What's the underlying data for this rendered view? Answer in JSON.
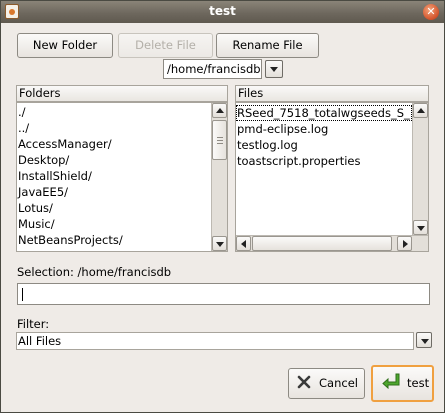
{
  "window": {
    "title": "test"
  },
  "toolbar": {
    "new_folder": "New Folder",
    "delete_file": "Delete File",
    "rename_file": "Rename File"
  },
  "path_combo": {
    "value": "/home/francisdb"
  },
  "folders": {
    "header": "Folders",
    "items": [
      {
        "label": "./"
      },
      {
        "label": "../"
      },
      {
        "label": "AccessManager/"
      },
      {
        "label": "Desktop/"
      },
      {
        "label": "InstallShield/"
      },
      {
        "label": "JavaEE5/"
      },
      {
        "label": "Lotus/"
      },
      {
        "label": "Music/"
      },
      {
        "label": "NetBeansProjects/"
      }
    ]
  },
  "files": {
    "header": "Files",
    "items": [
      {
        "label": "RSeed_7518_totalwgseeds_S_"
      },
      {
        "label": "pmd-eclipse.log"
      },
      {
        "label": "testlog.log"
      },
      {
        "label": "toastscript.properties"
      }
    ]
  },
  "selection": {
    "label": "Selection: /home/francisdb",
    "value": ""
  },
  "filter": {
    "label": "Filter:",
    "value": "All Files"
  },
  "actions": {
    "cancel": "Cancel",
    "ok": "test"
  },
  "icons": {
    "close": "close-icon",
    "cancel": "cancel-x-icon",
    "ok": "green-enter-arrow-icon",
    "app": "java-cup-icon"
  }
}
